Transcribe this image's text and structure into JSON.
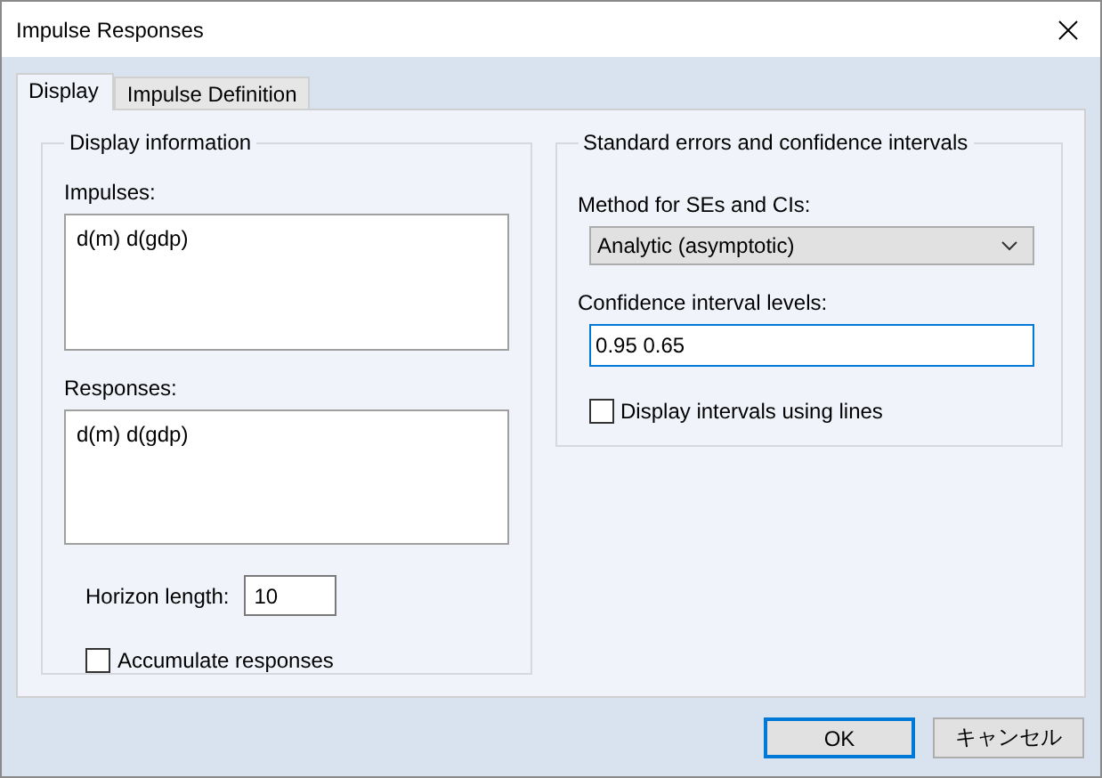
{
  "window": {
    "title": "Impulse Responses"
  },
  "tabs": [
    {
      "label": "Display",
      "selected": true
    },
    {
      "label": "Impulse Definition",
      "selected": false
    }
  ],
  "display_information": {
    "title": "Display information",
    "impulses": {
      "label": "Impulses:",
      "value": "d(m) d(gdp)"
    },
    "responses": {
      "label": "Responses:",
      "value": "d(m) d(gdp)"
    },
    "horizon": {
      "label": "Horizon length:",
      "value": "10"
    },
    "accumulate": {
      "label": "Accumulate responses",
      "checked": false
    }
  },
  "standard_errors": {
    "title": "Standard errors and confidence intervals",
    "method": {
      "label": "Method for SEs and CIs:",
      "value": "Analytic (asymptotic)"
    },
    "levels": {
      "label": "Confidence interval levels:",
      "value": "0.95 0.65",
      "focused": true
    },
    "lines": {
      "label": "Display intervals using lines",
      "checked": false
    }
  },
  "buttons": [
    {
      "label": "OK",
      "default": true
    },
    {
      "label": "キャンセル",
      "default": false
    }
  ]
}
